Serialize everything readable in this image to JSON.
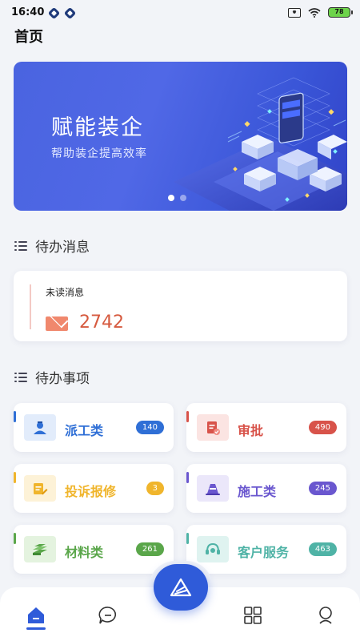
{
  "status_bar": {
    "time": "16:40",
    "battery": "78"
  },
  "header": {
    "title": "首页"
  },
  "banner": {
    "title": "赋能装企",
    "subtitle": "帮助装企提高效率",
    "slides": 2,
    "active_slide": 0
  },
  "todo_messages": {
    "section_title": "待办消息",
    "unread_label": "未读消息",
    "unread_count": "2742"
  },
  "todo_items": {
    "section_title": "待办事项",
    "items": [
      {
        "label": "派工类",
        "count": "140",
        "color": "#2f6fd6",
        "bg": "#e2ecfb"
      },
      {
        "label": "审批",
        "count": "490",
        "color": "#d8534a",
        "bg": "#fbe4e2"
      },
      {
        "label": "投诉报修",
        "count": "3",
        "color": "#f0b52c",
        "bg": "#fdf2d7"
      },
      {
        "label": "施工类",
        "count": "245",
        "color": "#6a57cf",
        "bg": "#ebe7fa"
      },
      {
        "label": "材料类",
        "count": "261",
        "color": "#5aa64a",
        "bg": "#e4f3df"
      },
      {
        "label": "客户服务",
        "count": "463",
        "color": "#4fb3a6",
        "bg": "#dff3f0"
      }
    ]
  },
  "tab_bar": {
    "tabs": [
      {
        "name": "home-icon",
        "active": true
      },
      {
        "name": "message-icon",
        "active": false
      },
      {
        "name": "apps-grid-icon",
        "active": false
      },
      {
        "name": "profile-icon",
        "active": false
      }
    ],
    "center_action": "logo-triangle-icon"
  }
}
